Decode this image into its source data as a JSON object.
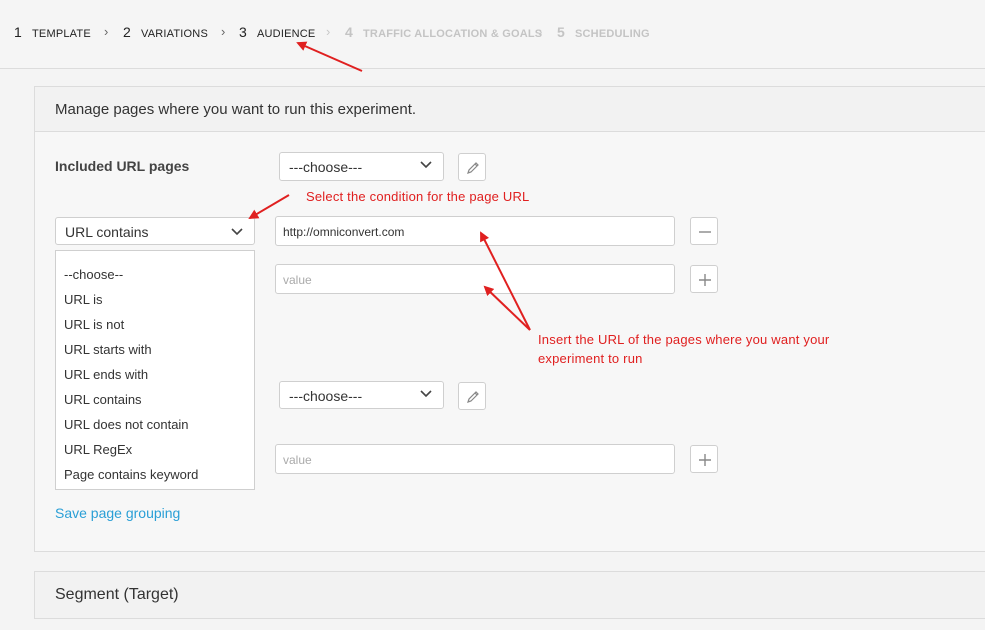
{
  "steps": [
    {
      "num": "1",
      "label": "TEMPLATE",
      "state": "active"
    },
    {
      "num": "2",
      "label": "VARIATIONS",
      "state": "active"
    },
    {
      "num": "3",
      "label": "AUDIENCE",
      "state": "active"
    },
    {
      "num": "4",
      "label": "TRAFFIC ALLOCATION & GOALS",
      "state": "disabled"
    },
    {
      "num": "5",
      "label": "SCHEDULING",
      "state": "disabled"
    }
  ],
  "panel": {
    "title": "Manage pages where you want to run this experiment.",
    "included_label": "Included URL pages",
    "choose_select": "---choose---",
    "condition_select": "URL contains",
    "url_value": "http://omniconvert.com",
    "value_placeholder": "value",
    "second_choose_select": "---choose---",
    "save_link": "Save page grouping"
  },
  "dropdown_options": [
    "--choose--",
    "URL is",
    "URL is not",
    "URL starts with",
    "URL ends with",
    "URL contains",
    "URL does not contain",
    "URL RegEx",
    "Page contains keyword"
  ],
  "segment_title": "Segment (Target)",
  "annotations": {
    "condition": "Select the condition for the page URL",
    "url_line1": "Insert the URL of the pages where you want your",
    "url_line2": "experiment to run"
  },
  "colors": {
    "annotation": "#e02020",
    "link": "#2a9fd6"
  }
}
